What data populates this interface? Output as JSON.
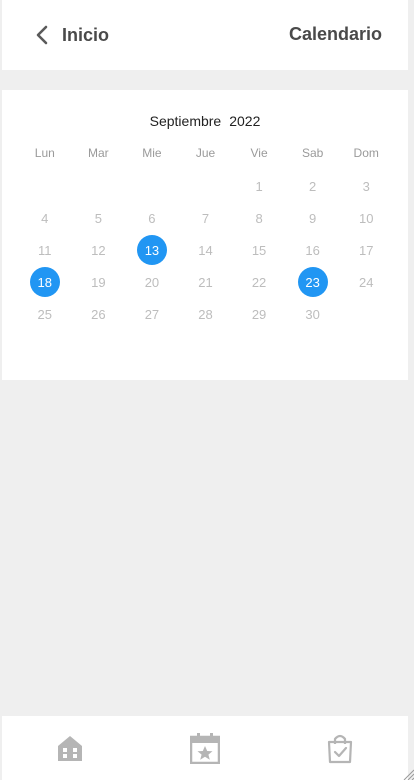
{
  "header": {
    "back_label": "Inicio",
    "title": "Calendario"
  },
  "calendar": {
    "month": "Septiembre",
    "year": "2022",
    "weekdays": [
      "Lun",
      "Mar",
      "Mie",
      "Jue",
      "Vie",
      "Sab",
      "Dom"
    ],
    "days": [
      {
        "label": "",
        "marked": false
      },
      {
        "label": "",
        "marked": false
      },
      {
        "label": "",
        "marked": false
      },
      {
        "label": "",
        "marked": false
      },
      {
        "label": "1",
        "marked": false
      },
      {
        "label": "2",
        "marked": false
      },
      {
        "label": "3",
        "marked": false
      },
      {
        "label": "4",
        "marked": false
      },
      {
        "label": "5",
        "marked": false
      },
      {
        "label": "6",
        "marked": false
      },
      {
        "label": "7",
        "marked": false
      },
      {
        "label": "8",
        "marked": false
      },
      {
        "label": "9",
        "marked": false
      },
      {
        "label": "10",
        "marked": false
      },
      {
        "label": "11",
        "marked": false
      },
      {
        "label": "12",
        "marked": false
      },
      {
        "label": "13",
        "marked": true
      },
      {
        "label": "14",
        "marked": false
      },
      {
        "label": "15",
        "marked": false
      },
      {
        "label": "16",
        "marked": false
      },
      {
        "label": "17",
        "marked": false
      },
      {
        "label": "18",
        "marked": true
      },
      {
        "label": "19",
        "marked": false
      },
      {
        "label": "20",
        "marked": false
      },
      {
        "label": "21",
        "marked": false
      },
      {
        "label": "22",
        "marked": false
      },
      {
        "label": "23",
        "marked": true
      },
      {
        "label": "24",
        "marked": false
      },
      {
        "label": "25",
        "marked": false
      },
      {
        "label": "26",
        "marked": false
      },
      {
        "label": "27",
        "marked": false
      },
      {
        "label": "28",
        "marked": false
      },
      {
        "label": "29",
        "marked": false
      },
      {
        "label": "30",
        "marked": false
      }
    ],
    "marked_color": "#2196f3"
  },
  "bottom_nav": {
    "items": [
      {
        "icon": "home-icon"
      },
      {
        "icon": "calendar-star-icon"
      },
      {
        "icon": "shopping-bag-check-icon"
      }
    ]
  },
  "colors": {
    "background": "#efefef",
    "text_dark": "#4a4a4a",
    "text_muted": "#bdbdbd",
    "icon_gray": "#b5b5b5"
  }
}
